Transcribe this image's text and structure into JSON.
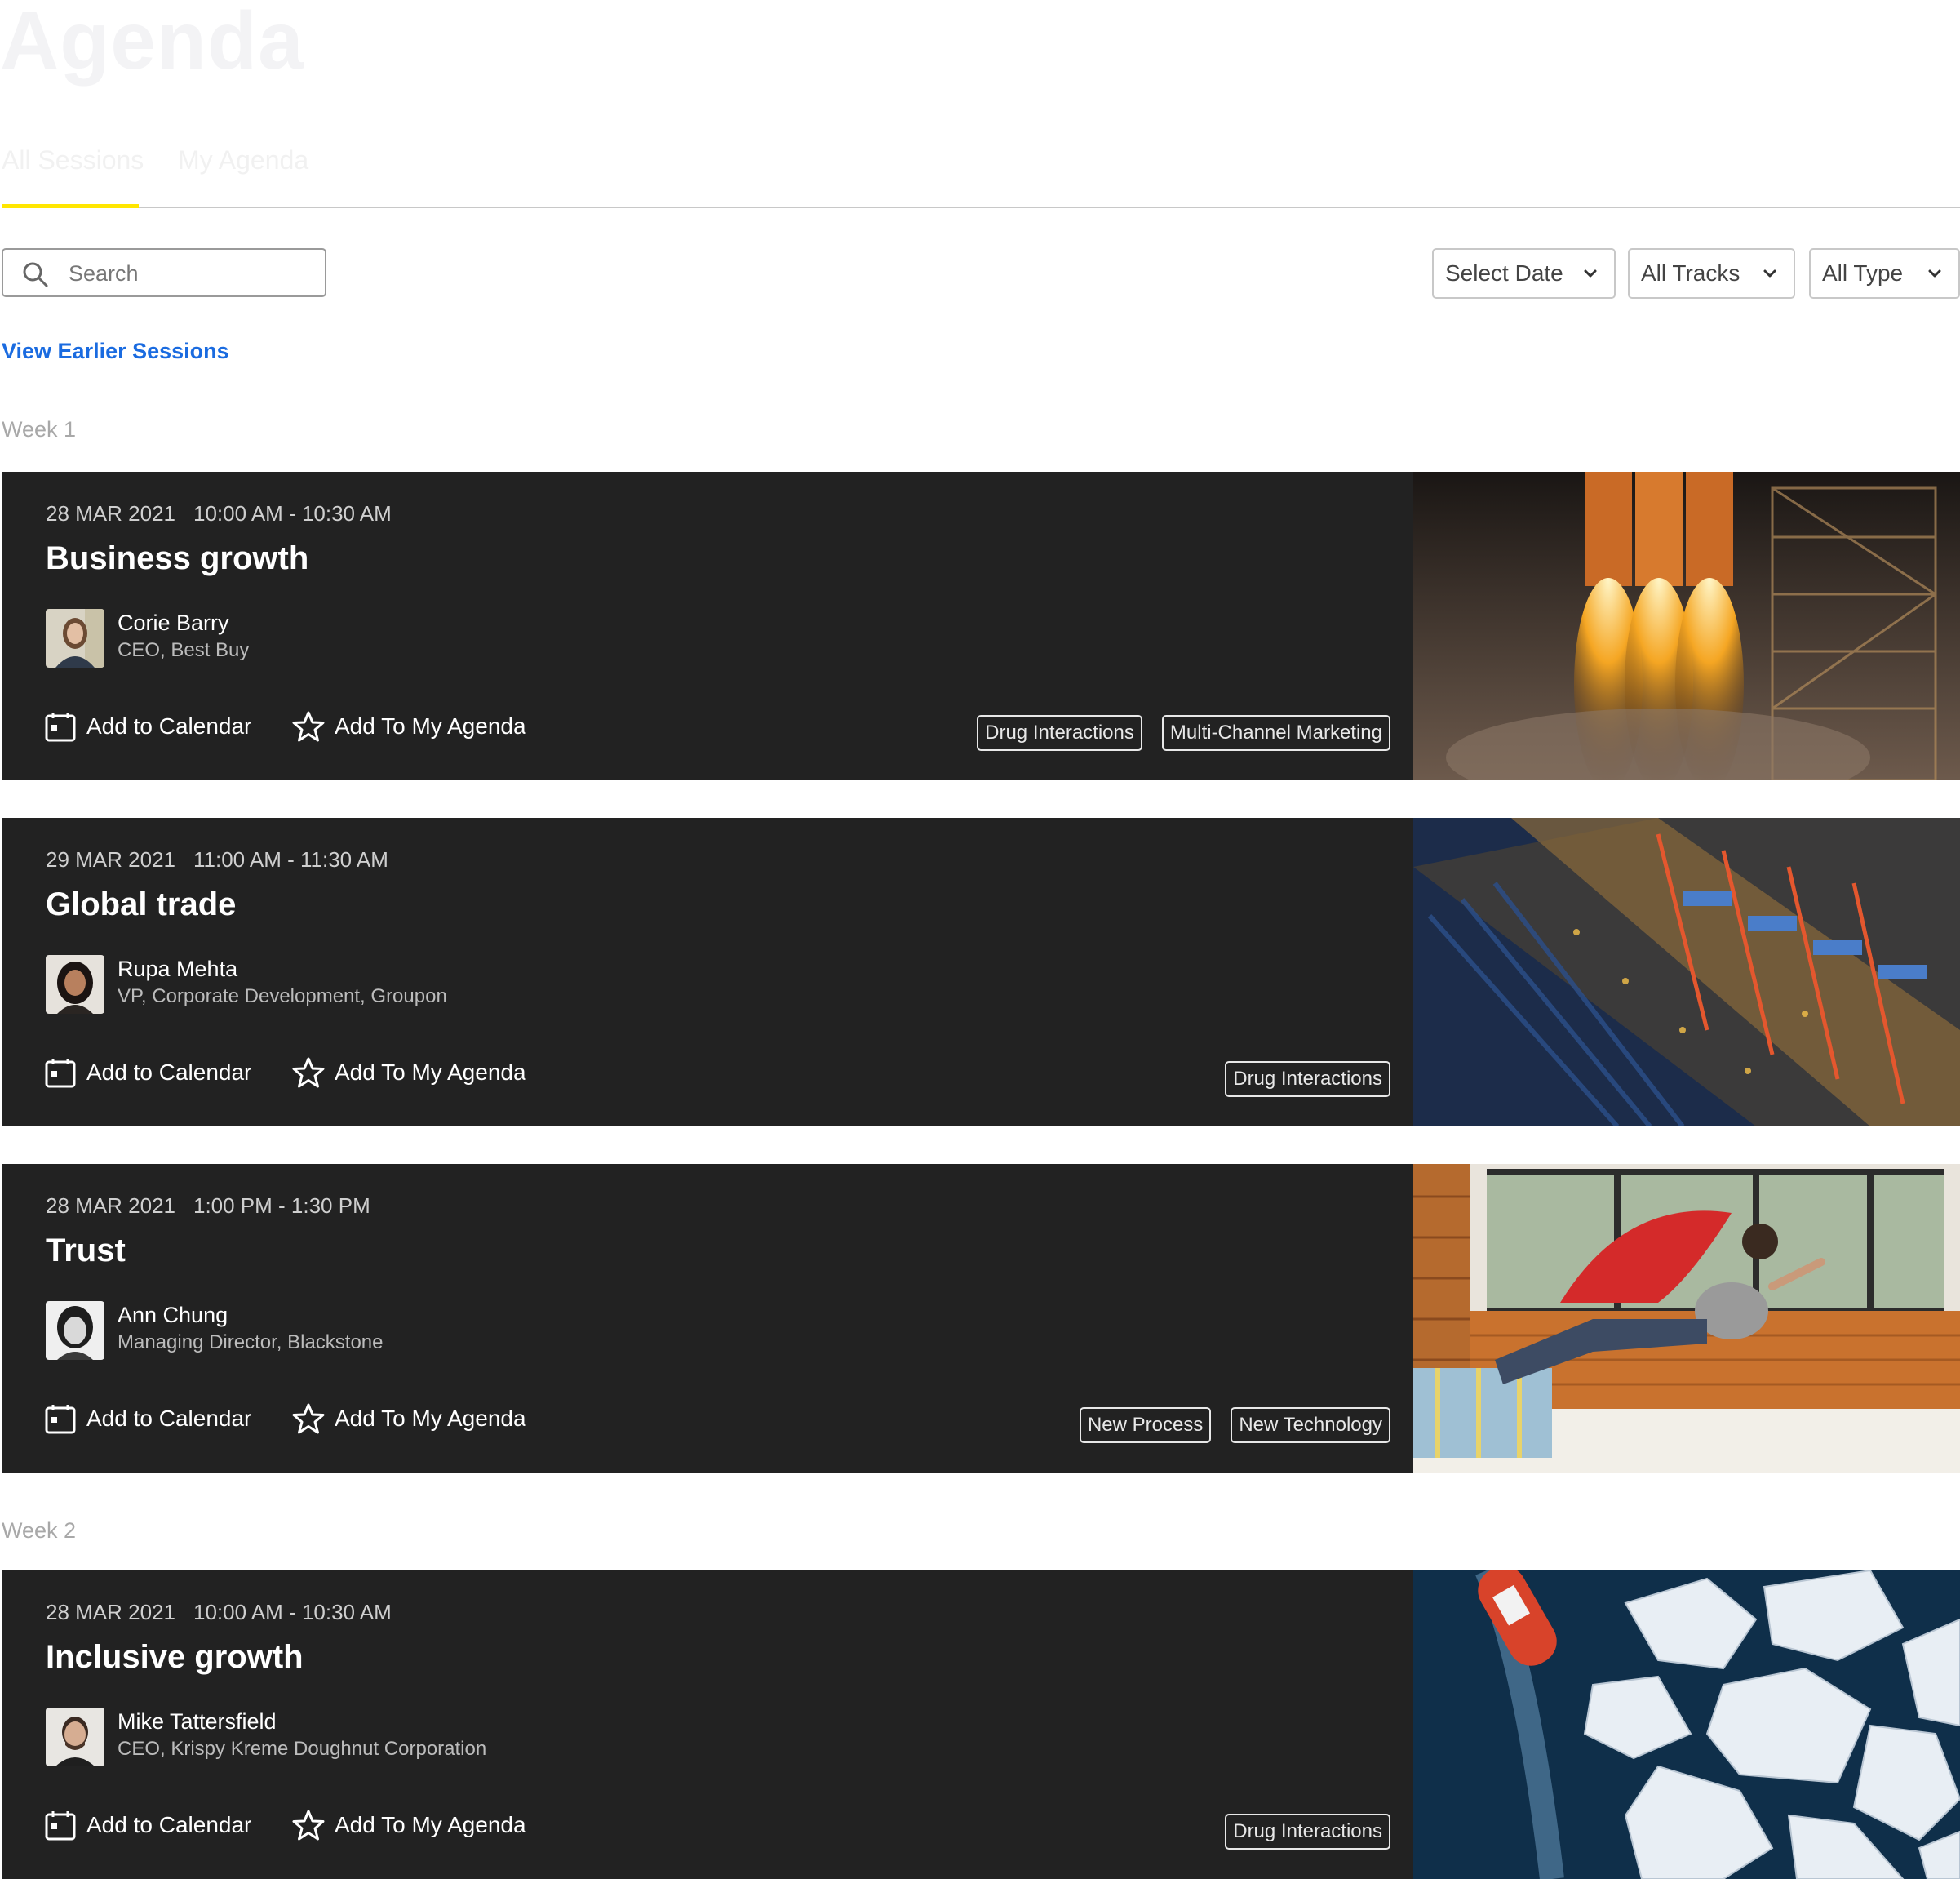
{
  "page": {
    "title": "Agenda"
  },
  "tabs": [
    {
      "label": "All Sessions",
      "active": true
    },
    {
      "label": "My Agenda",
      "active": false
    }
  ],
  "search": {
    "placeholder": "Search",
    "value": ""
  },
  "filters": {
    "date": {
      "label": "Select Date"
    },
    "tracks": {
      "label": "All Tracks"
    },
    "type": {
      "label": "All Type"
    }
  },
  "earlier_link": "View Earlier Sessions",
  "actions": {
    "add_calendar": "Add to Calendar",
    "add_agenda": "Add To My Agenda"
  },
  "weeks": [
    {
      "label": "Week 1",
      "sessions": [
        {
          "date": "28 MAR 2021",
          "time": "10:00 AM - 10:30 AM",
          "title": "Business growth",
          "speaker": "Corie Barry",
          "role": "CEO, Best Buy",
          "tags": [
            "Drug Interactions",
            "Multi-Channel Marketing"
          ]
        },
        {
          "date": "29 MAR 2021",
          "time": "11:00 AM - 11:30 AM",
          "title": "Global trade",
          "speaker": "Rupa Mehta",
          "role": "VP, Corporate Development, Groupon",
          "tags": [
            "Drug Interactions"
          ]
        },
        {
          "date": "28 MAR 2021",
          "time": "1:00 PM - 1:30 PM",
          "title": "Trust",
          "speaker": "Ann Chung",
          "role": "Managing Director, Blackstone",
          "tags": [
            "New Process",
            "New Technology"
          ]
        }
      ]
    },
    {
      "label": "Week 2",
      "sessions": [
        {
          "date": "28 MAR 2021",
          "time": "10:00 AM - 10:30 AM",
          "title": "Inclusive growth",
          "speaker": "Mike Tattersfield",
          "role": "CEO, Krispy Kreme Doughnut Corporation",
          "tags": [
            "Drug Interactions"
          ]
        }
      ]
    }
  ],
  "colors": {
    "accent": "#ffe600",
    "link": "#1a6be0",
    "card_bg": "#222222"
  }
}
